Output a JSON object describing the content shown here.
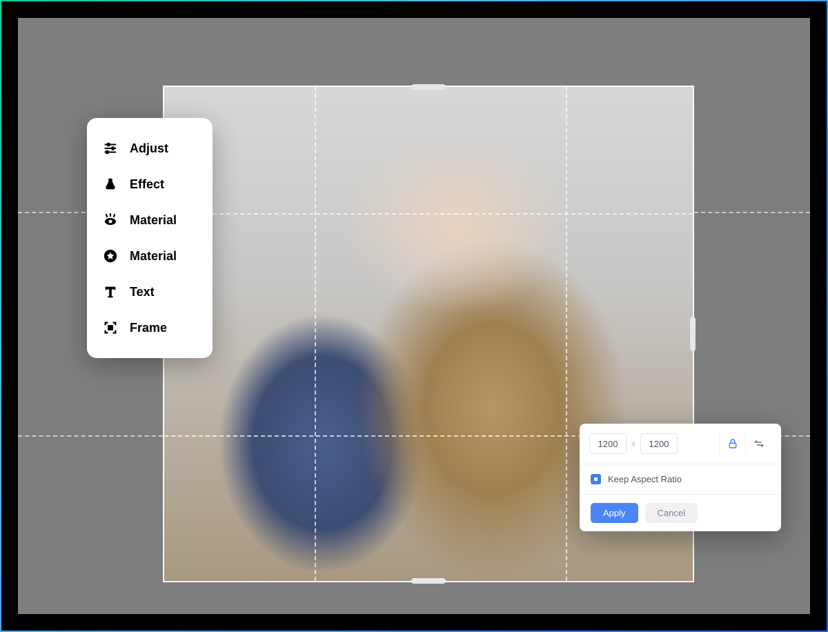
{
  "sidebar": {
    "items": [
      {
        "label": "Adjust",
        "icon": "sliders-icon"
      },
      {
        "label": "Effect",
        "icon": "flask-icon"
      },
      {
        "label": "Material",
        "icon": "eye-icon"
      },
      {
        "label": "Material",
        "icon": "star-badge-icon"
      },
      {
        "label": "Text",
        "icon": "text-t-icon"
      },
      {
        "label": "Frame",
        "icon": "frame-icon"
      }
    ]
  },
  "size_panel": {
    "width_value": "1200",
    "height_value": "1200",
    "separator": "x",
    "keep_aspect_label": "Keep Aspect Ratio",
    "keep_aspect_checked": true,
    "apply_label": "Apply",
    "cancel_label": "Cancel"
  },
  "colors": {
    "accent": "#4a84f7",
    "lock_icon": "#3b82f6"
  }
}
